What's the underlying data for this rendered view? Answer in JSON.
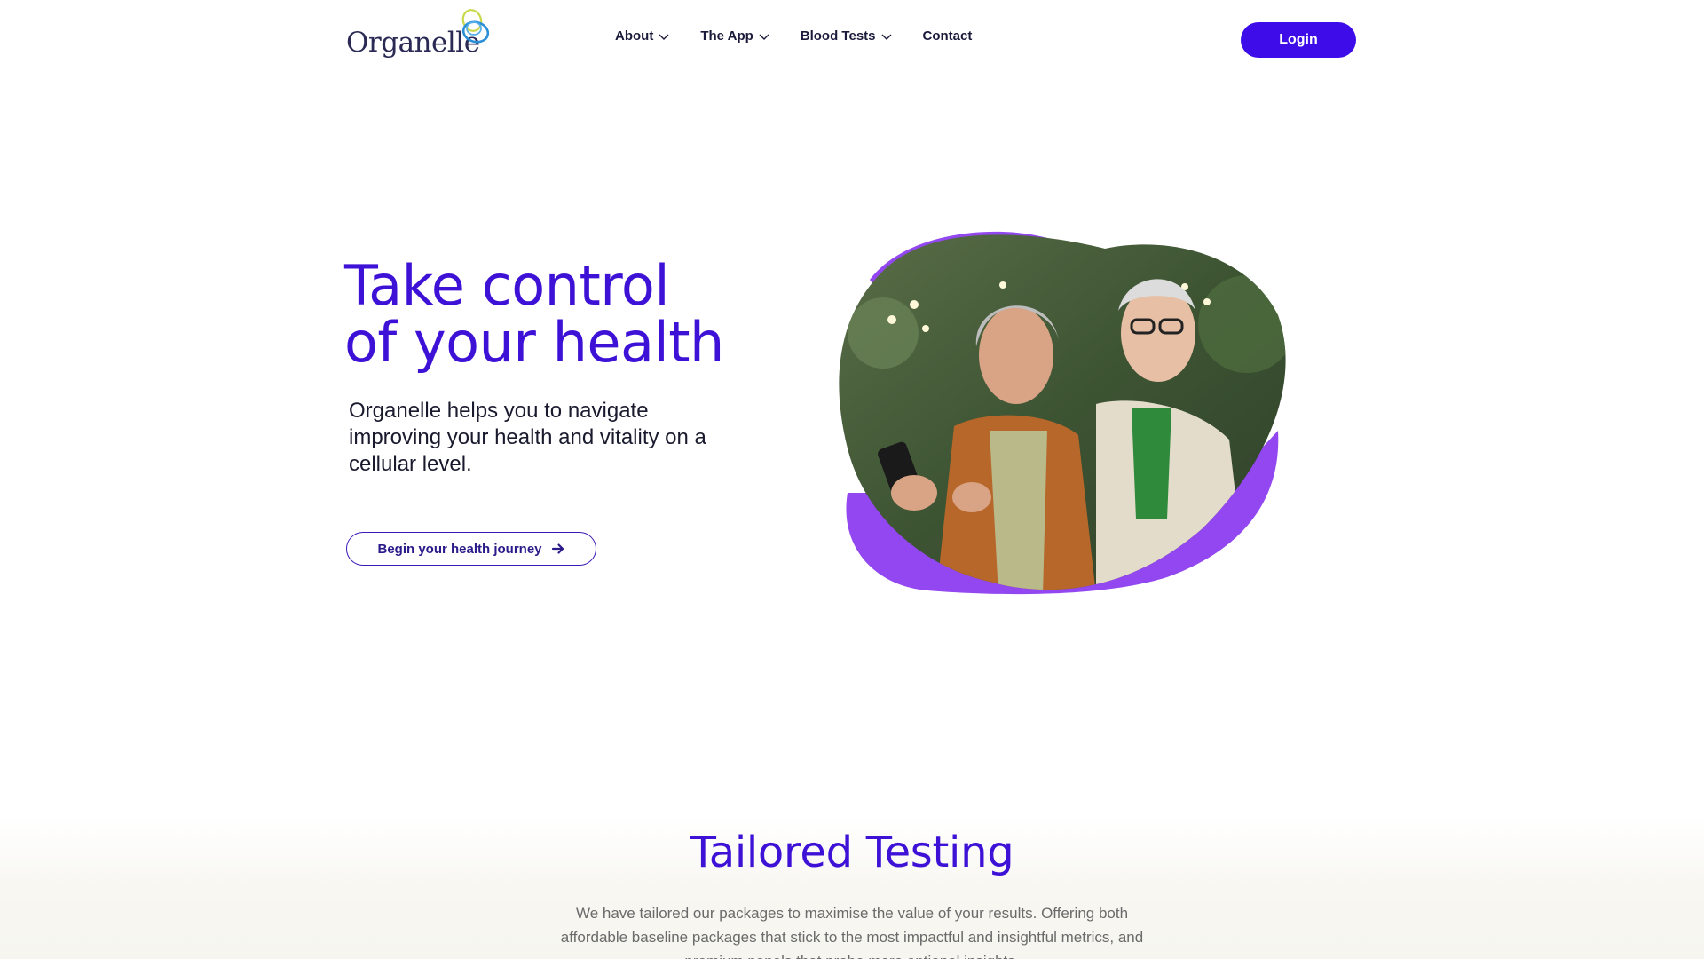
{
  "brand": {
    "name": "Organelle",
    "primary_color": "#3e12d6",
    "button_color": "#3d0ce8",
    "accent_purple": "#9247f0"
  },
  "nav": {
    "items": [
      {
        "label": "About",
        "has_dropdown": true
      },
      {
        "label": "The App",
        "has_dropdown": true
      },
      {
        "label": "Blood Tests",
        "has_dropdown": true
      },
      {
        "label": "Contact",
        "has_dropdown": false
      }
    ],
    "login_label": "Login"
  },
  "hero": {
    "title_line1": "Take control",
    "title_line2": "of your health",
    "subtitle": "Organelle helps you to navigate improving your health and vitality on a cellular level.",
    "cta_label": "Begin your health journey",
    "cta_icon": "arrow-right-icon",
    "image_icon": "couple-with-phone-photo"
  },
  "tailored": {
    "title": "Tailored Testing",
    "body": "We have tailored our packages to maximise the value of your results. Offering both affordable baseline packages that stick to the most impactful and insightful metrics, and premium panels that probe more optional insights."
  }
}
